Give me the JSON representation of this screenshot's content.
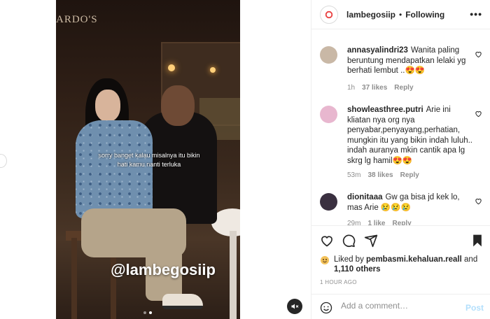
{
  "video": {
    "sign_text": "ARDO'S",
    "subtitle": "sorry banget kalau misalnya itu bikin hati kamu nanti terluka",
    "watermark": "@lambegosiip",
    "slide_count": 2,
    "active_slide": 2
  },
  "header": {
    "username": "lambegosiip",
    "dot": "•",
    "follow_status": "Following",
    "more": "•••"
  },
  "comments": [
    {
      "username": "annasyalindri23",
      "text": "Wanita paling beruntung mendapatkan lelaki yg berhati lembut ..😍😍",
      "time": "1h",
      "likes": "37 likes",
      "reply": "Reply",
      "avatar_color": "#c9b8a6"
    },
    {
      "username": "showleasthree.putri",
      "text": "Arie ini kliatan nya org nya penyabar,penyayang,perhatian, mungkin itu yang bikin indah luluh.. indah auranya mkin cantik apa lg skrg lg hamil😍😍",
      "time": "53m",
      "likes": "38 likes",
      "reply": "Reply",
      "avatar_color": "#e8b7cf"
    },
    {
      "username": "dionitaaa",
      "text": "Gw ga bisa jd kek lo, mas Arie 😢😢😢",
      "time": "29m",
      "likes": "1 like",
      "reply": "Reply",
      "avatar_color": "#3a3040"
    }
  ],
  "likes": {
    "prefix": "Liked by ",
    "liker": "pembasmi.kehaluan.reall",
    "and": " and ",
    "others": "1,110 others"
  },
  "timestamp": "1 HOUR AGO",
  "comment_box": {
    "placeholder": "Add a comment…",
    "post_label": "Post"
  },
  "colors": {
    "accent_disabled": "#b2dffc",
    "text_primary": "#262626",
    "text_secondary": "#8e8e8e",
    "border": "#efefef"
  },
  "icons": [
    "heart-icon",
    "comment-icon",
    "share-icon",
    "bookmark-icon",
    "emoji-icon",
    "mute-icon",
    "more-icon"
  ]
}
